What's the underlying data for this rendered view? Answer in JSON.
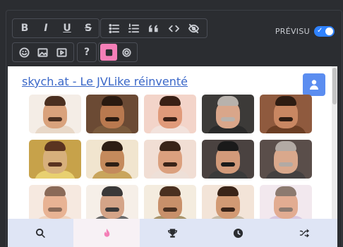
{
  "toolbar": {
    "format_buttons": [
      {
        "name": "bold-icon",
        "glyph": "B"
      },
      {
        "name": "italic-icon",
        "glyph": "I"
      },
      {
        "name": "underline-icon",
        "glyph": "U"
      },
      {
        "name": "strikethrough-icon",
        "glyph": "S"
      }
    ],
    "block_buttons": [
      "bullet-list-icon",
      "numbered-list-icon",
      "quote-icon",
      "code-icon",
      "spoiler-eye-slash-icon"
    ],
    "media_buttons": [
      "emoji-icon",
      "image-icon",
      "video-icon"
    ],
    "help_glyph": "?",
    "sticker_buttons": [
      "sticker-icon",
      "settings-icon"
    ],
    "preview_label": "PRÉVISU",
    "preview_on": true,
    "preview_check": "✓"
  },
  "panel": {
    "link_text": "skych.at - Le JVLike réinventé",
    "user_button_icon": "user-icon",
    "stickers": [
      {
        "bg": "#f4ede6",
        "skin": "#d9a27c",
        "hair": "#4a2f20",
        "body": "#e8d8c8"
      },
      {
        "bg": "#6b4a34",
        "skin": "#b9794f",
        "hair": "#2a1a10",
        "body": "#7a5a3c"
      },
      {
        "bg": "#f3d4c9",
        "skin": "#e09a7a",
        "hair": "#3a2015",
        "body": "#f2e2dc"
      },
      {
        "bg": "#3c3a38",
        "skin": "#d9a68a",
        "hair": "#b8b2ac",
        "body": "#2a2a2a"
      },
      {
        "bg": "#8f5a3e",
        "skin": "#c98762",
        "hair": "#2e1c12",
        "body": "#6b3e24"
      },
      {
        "bg": "#c7a24a",
        "skin": "#d7b07c",
        "hair": "#5a3420",
        "body": "#e8d070"
      },
      {
        "bg": "#f1e5cf",
        "skin": "#c48a5c",
        "hair": "#2d1e14",
        "body": "#c9a55c"
      },
      {
        "bg": "#f1ded4",
        "skin": "#dba07e",
        "hair": "#3a2418",
        "body": "#eee0d8"
      },
      {
        "bg": "#4a4240",
        "skin": "#d29a7a",
        "hair": "#1a1a1a",
        "body": "#3a3a3a"
      },
      {
        "bg": "#5a4e4a",
        "skin": "#d9a88c",
        "hair": "#b2aaa4",
        "body": "#444040"
      },
      {
        "bg": "#f6e9e0",
        "skin": "#e8b394",
        "hair": "#8a6a58",
        "body": "#f0d4c0"
      },
      {
        "bg": "#f6efe8",
        "skin": "#d4a488",
        "hair": "#3a3838",
        "body": "#6a6a6a"
      },
      {
        "bg": "#f4ecdf",
        "skin": "#c8906a",
        "hair": "#4a3020",
        "body": "#a8946a"
      },
      {
        "bg": "#f3e4d8",
        "skin": "#d29a74",
        "hair": "#3a2418",
        "body": "#c8bca8"
      },
      {
        "bg": "#f2e8ee",
        "skin": "#e2ac92",
        "hair": "#8c7a70",
        "body": "#d8c8e0"
      }
    ]
  },
  "bottom_nav": [
    {
      "icon": "search-icon",
      "active": false
    },
    {
      "icon": "fire-icon",
      "active": true
    },
    {
      "icon": "trophy-icon",
      "active": false
    },
    {
      "icon": "clock-icon",
      "active": false
    },
    {
      "icon": "shuffle-icon",
      "active": false
    }
  ],
  "colors": {
    "accent_pink": "#f47fb7",
    "link_blue": "#3a67c8",
    "toggle_blue": "#2f82ff",
    "user_button_blue": "#5b8df0",
    "bar_bg": "#dfe5f5"
  }
}
